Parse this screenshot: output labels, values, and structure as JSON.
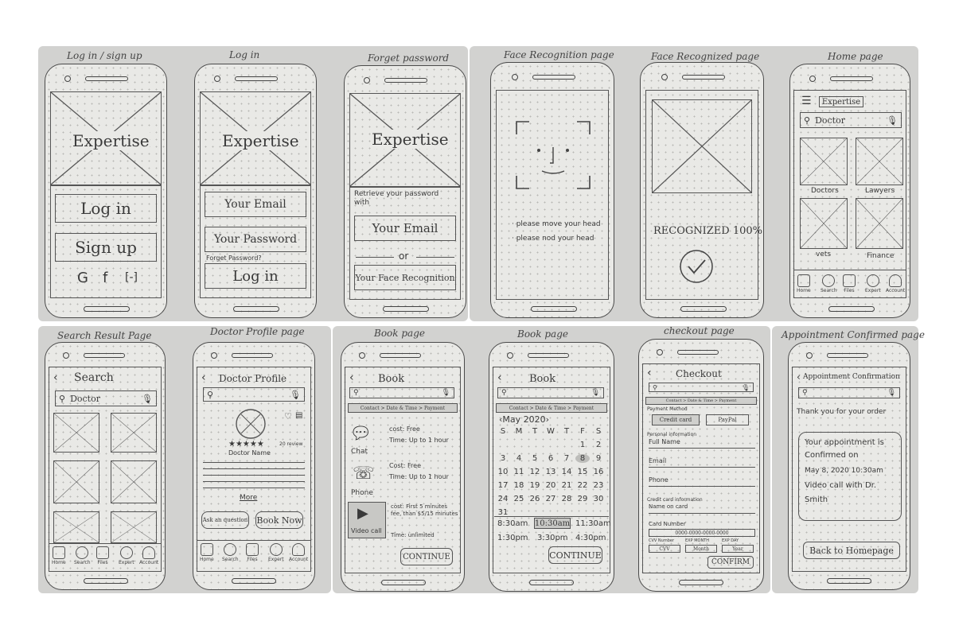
{
  "row1": {
    "left_panel_titles": [
      "Log in / sign up",
      "Log in",
      "Forget password"
    ],
    "right_panel_titles": [
      "Face Recognition page",
      "Face Recognized page",
      "Home page"
    ]
  },
  "row2": {
    "titles": [
      "Search Result Page",
      "Doctor Profile page",
      "Book page",
      "Book page",
      "checkout page",
      "Appointment Confirmed page"
    ]
  },
  "login_signup": {
    "logo": "Expertise",
    "login_button": "Log in",
    "signup_button": "Sign up",
    "social": [
      "G",
      "f",
      "[-]"
    ]
  },
  "login": {
    "logo": "Expertise",
    "email_placeholder": "Your Email",
    "password_placeholder": "Your Password",
    "forget_link": "Forget Password?",
    "login_button": "Log in"
  },
  "forget_password": {
    "logo": "Expertise",
    "prompt": "Retrieve your password with",
    "email_placeholder": "Your Email",
    "or": "or",
    "face_option": "Your Face Recognition"
  },
  "face_recognition": {
    "hints": [
      "· please move your head",
      "· please nod your head"
    ]
  },
  "face_recognized": {
    "status": "RECOGNIZED 100%"
  },
  "home": {
    "brand": "Expertise",
    "search_value": "Doctor",
    "categories": [
      "Doctors",
      "Lawyers",
      "vets",
      "Finance"
    ],
    "tabs": [
      "Home",
      "Search",
      "Files",
      "Expert",
      "Account"
    ]
  },
  "search_result": {
    "title": "Search",
    "search_value": "Doctor",
    "tabs": [
      "Home",
      "Search",
      "Files",
      "Expert",
      "Account"
    ]
  },
  "doctor_profile": {
    "title": "Doctor Profile",
    "rating_stars": "★★★★★",
    "review_count": "20 review",
    "doctor_name": "Doctor Name",
    "more_link": "More",
    "ask_button": "Ask an question",
    "book_button": "Book Now",
    "tabs": [
      "Home",
      "Search",
      "Files",
      "Expert",
      "Account"
    ]
  },
  "book_page_1": {
    "title": "Book",
    "stepper": "Contact > Date & Time > Payment",
    "options": [
      {
        "label": "Chat",
        "cost": "cost: Free",
        "time": "Time: Up to 1 hour"
      },
      {
        "label": "Phone",
        "cost": "Cost: Free",
        "time": "Time: Up to 1 hour"
      },
      {
        "label": "Video call",
        "cost": "cost: First 5 minutes fee, than $5/15 minutes",
        "time": "Time: unlimited"
      }
    ],
    "continue_button": "CONTINUE"
  },
  "book_page_2": {
    "title": "Book",
    "stepper": "Contact > Date & Time > Payment",
    "month": "May 2020",
    "weekdays": [
      "S",
      "M",
      "T",
      "W",
      "T",
      "F",
      "S"
    ],
    "days": [
      "1",
      "2",
      "3",
      "4",
      "5",
      "6",
      "7",
      "8",
      "9",
      "10",
      "11",
      "12",
      "13",
      "14",
      "15",
      "16",
      "17",
      "18",
      "19",
      "20",
      "21",
      "22",
      "23",
      "24",
      "25",
      "26",
      "27",
      "28",
      "29",
      "30",
      "31"
    ],
    "selected_day": "8",
    "times_row1": [
      "8:30am",
      "10:30am",
      "11:30am"
    ],
    "times_row2": [
      "1:30pm",
      "3:30pm",
      "4:30pm"
    ],
    "selected_time": "10:30am",
    "continue_button": "CONTINUE"
  },
  "checkout": {
    "title": "Checkout",
    "stepper": "Contact > Date & Time > Payment",
    "payment_method_label": "Payment Method",
    "credit_card": "Credit card",
    "paypal": "PayPal",
    "personal_info_label": "Personal information",
    "full_name": "Full Name",
    "email": "Email",
    "phone": "Phone",
    "card_info_label": "Credit card information",
    "name_on_card": "Name on card",
    "card_number": "Card Number",
    "card_number_value": "0000-0000-0000-0000",
    "cvv_label": "CVV Number",
    "exp_month_label": "EXP MONTH",
    "exp_day_label": "EXP DAY",
    "cvv_value": "CVV",
    "month_value": "Month",
    "year_value": "Year",
    "confirm_button": "CONFIRM"
  },
  "confirmation": {
    "title": "Appointment Confirmation",
    "thanks": "Thank you for your order",
    "line1": "Your appointment is",
    "line2": "Confirmed on",
    "line3": "May 8, 2020 10:30am",
    "line4": "Video call with Dr.",
    "line5": "Smith",
    "back_button": "Back to Homepage"
  },
  "icons": [
    "search-icon",
    "mic-icon",
    "heart-icon",
    "share-icon",
    "home-icon",
    "files-icon",
    "expert-icon",
    "account-icon",
    "check-icon",
    "chat-icon",
    "phone-icon",
    "video-icon",
    "menu-icon",
    "back-icon"
  ]
}
